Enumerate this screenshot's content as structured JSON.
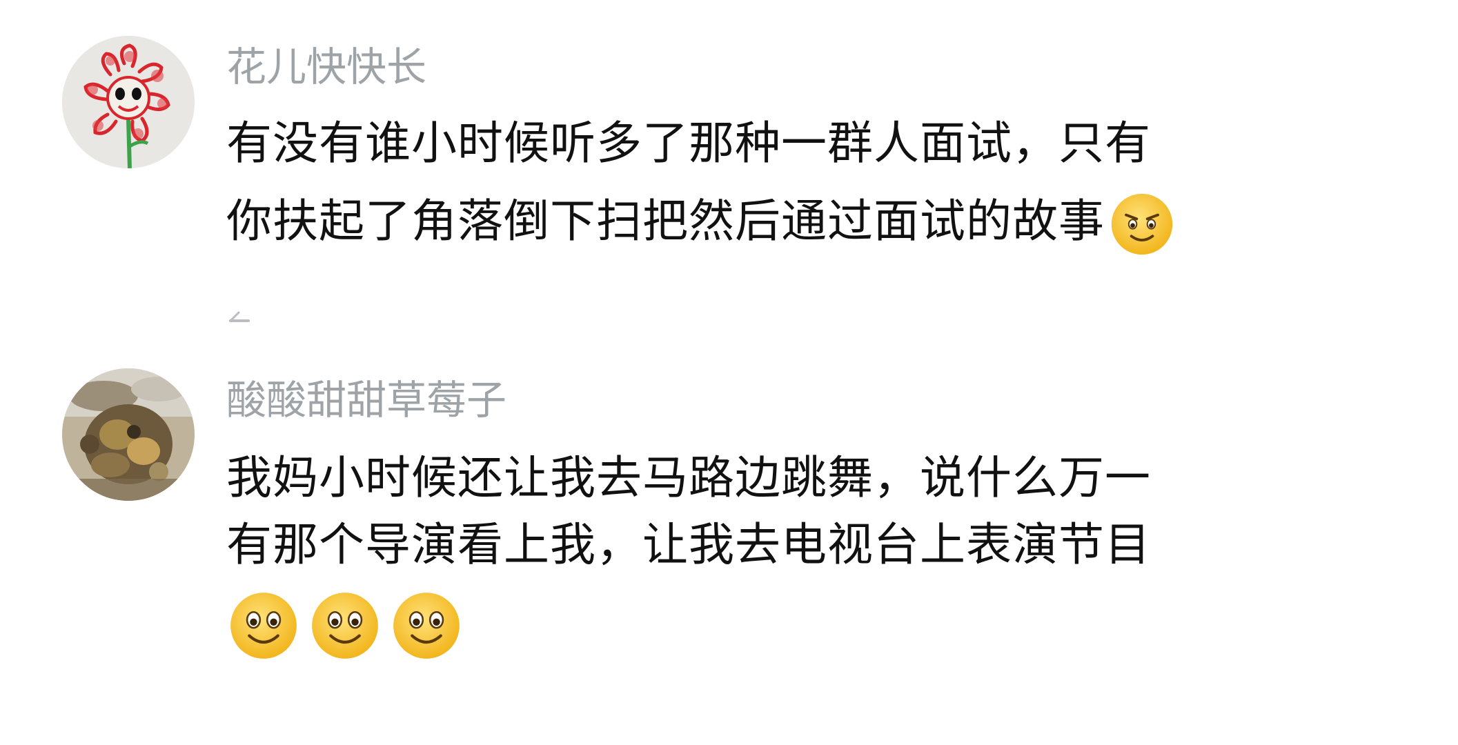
{
  "comments": [
    {
      "username": "花儿快快长",
      "lines": [
        "有没有谁小时候听多了那种一群人面试，只有",
        "你扶起了角落倒下扫把然后通过面试的故事"
      ],
      "avatar_icon": "flower-drawing-avatar",
      "trailing_emoji": "smirk-emoji-icon"
    },
    {
      "username": "酸酸甜甜草莓子",
      "lines": [
        "我妈小时候还让我去马路边跳舞，说什么万一",
        "有那个导演看上我，让我去电视台上表演节目"
      ],
      "avatar_icon": "photo-avatar",
      "trailing_emojis": [
        "grin-emoji-icon",
        "grin-emoji-icon",
        "grin-emoji-icon"
      ]
    }
  ],
  "colors": {
    "username": "#9ea3a8",
    "text": "#111111",
    "background": "#ffffff",
    "emoji_face": "#f7c531"
  }
}
